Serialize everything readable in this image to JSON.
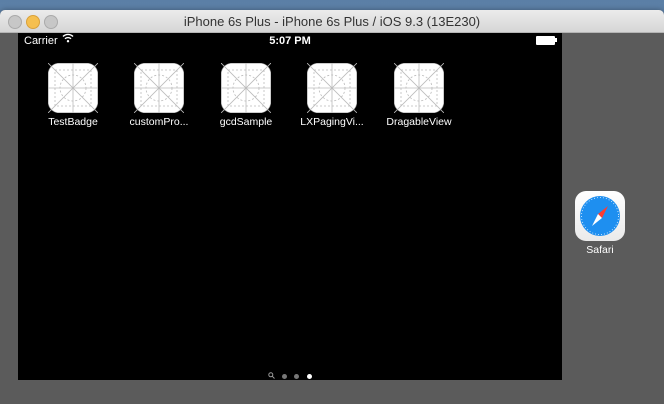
{
  "window": {
    "title": "iPhone 6s Plus - iPhone 6s Plus / iOS 9.3 (13E230)"
  },
  "statusbar": {
    "carrier": "Carrier",
    "wifi_icon": "wifi-icon",
    "time": "5:07 PM",
    "battery_icon": "battery-icon"
  },
  "apps": [
    {
      "label": "TestBadge",
      "icon": "placeholder-app-icon"
    },
    {
      "label": "customPro...",
      "icon": "placeholder-app-icon"
    },
    {
      "label": "gcdSample",
      "icon": "placeholder-app-icon"
    },
    {
      "label": "LXPagingVi...",
      "icon": "placeholder-app-icon"
    },
    {
      "label": "DragableView",
      "icon": "placeholder-app-icon"
    }
  ],
  "page_indicator": {
    "search_icon": "search-icon",
    "pages": 3,
    "current_page": 3
  },
  "dock": {
    "apps": [
      {
        "label": "Safari",
        "icon": "safari-compass-icon"
      }
    ]
  },
  "colors": {
    "screen_bg": "#000000",
    "dock_bg": "#5b5b5b",
    "title_text": "#333333",
    "minimize_light": "#f5bf4f"
  }
}
